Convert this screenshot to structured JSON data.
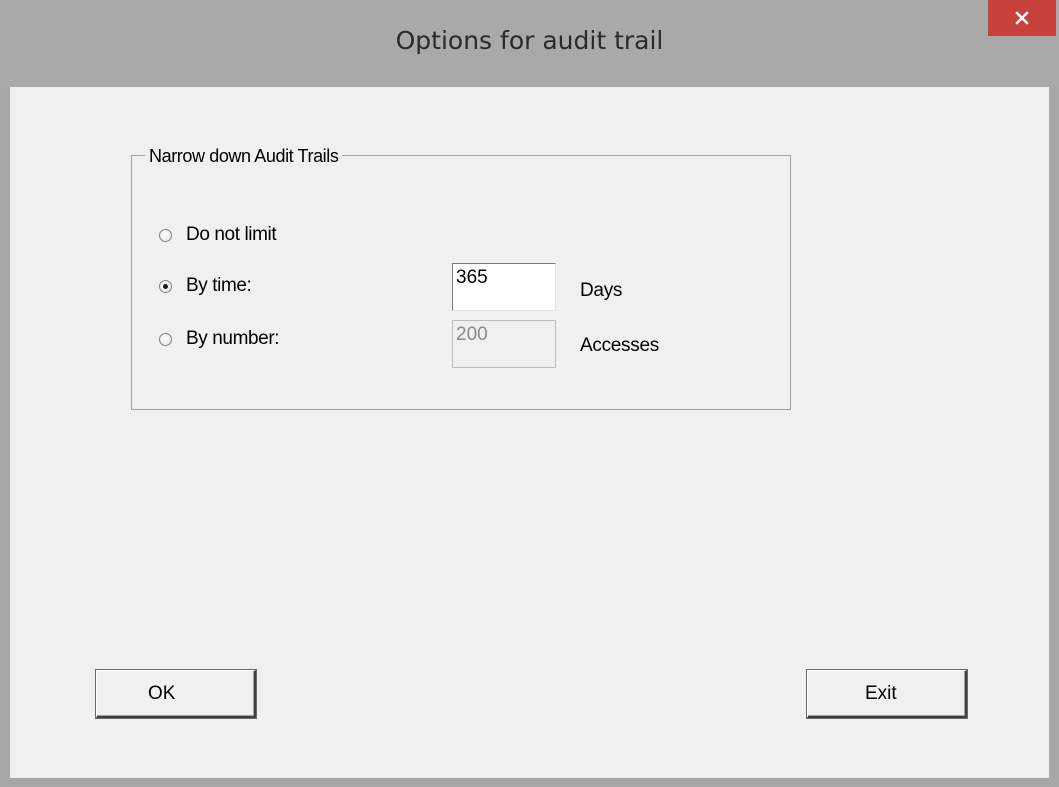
{
  "window": {
    "title": "Options for audit trail",
    "close_icon": "close-icon"
  },
  "group": {
    "legend": "Narrow down Audit Trails",
    "options": [
      {
        "label": "Do not limit",
        "checked": false
      },
      {
        "label": "By time:",
        "checked": true
      },
      {
        "label": "By number:",
        "checked": false
      }
    ],
    "time": {
      "value": "365",
      "unit": "Days",
      "enabled": true
    },
    "number": {
      "value": "200",
      "unit": "Accesses",
      "enabled": false
    }
  },
  "buttons": {
    "ok_label": "OK",
    "exit_label": "Exit"
  },
  "colors": {
    "titlebar": "#a9a9a9",
    "close_button": "#c7403a",
    "client_background": "#f0f0f0"
  }
}
